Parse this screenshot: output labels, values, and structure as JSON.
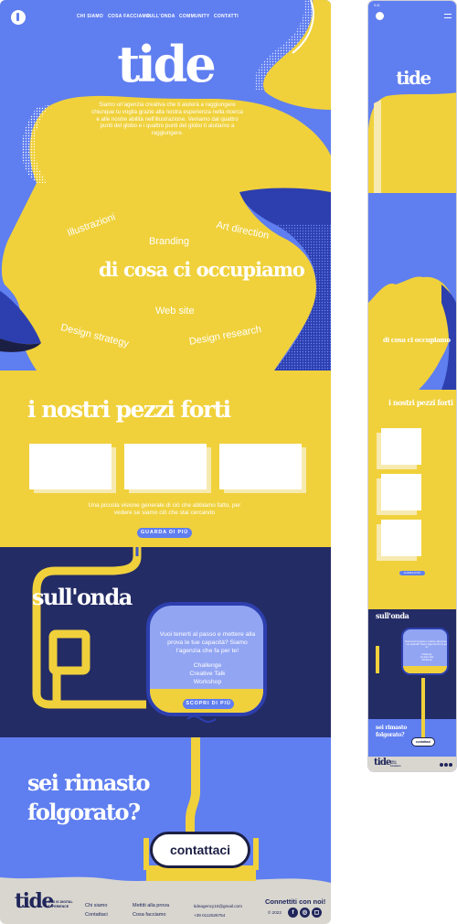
{
  "colors": {
    "blue": "#5f7ef0",
    "yellow": "#f0d13c",
    "navy": "#242c66",
    "ink": "#20265a",
    "beige": "#d8d6cf"
  },
  "nav": {
    "logo_icon": "tide-drop-icon",
    "links": [
      "CHI SIAMO",
      "COSA FACCIAMO",
      "SULL'ONDA",
      "COMMUNITY",
      "CONTATTI"
    ]
  },
  "hero": {
    "brand": "tide",
    "text": "Siamo un'agenzia creativa che ti aiuterà a raggiungere chiunque tu voglia grazie alla nostra esperienza nella ricerca e alle nostre abilità nell'illustrazione. Veniamo dal quattro punti del globo e i quattro punti del globo ti aiutiamo a raggiungere."
  },
  "services": {
    "title": "di cosa ci occupiamo",
    "items": [
      "Illustrazioni",
      "Branding",
      "Art direction",
      "Web site",
      "Design strategy",
      "Design research"
    ]
  },
  "strengths": {
    "title": "i nostri pezzi forti",
    "cards": [
      "",
      "",
      ""
    ],
    "text": "Una piccola visione generale di ciò che abbiamo fatto, per vedere se siamo ciò che stai cercando",
    "button": "GUARDA DI PIÙ"
  },
  "wave": {
    "title": "sull'onda",
    "text": "Vuoi tenerti al passo e mettere alla prova le tue capacità? Siamo l'agenzia che fa per te!",
    "items": [
      "Challenge",
      "Creative Talk",
      "Workshop"
    ],
    "button": "SCOPRI DI PIÙ"
  },
  "contact": {
    "title_line1": "sei rimasto",
    "title_line2": "folgorato?",
    "button": "contattaci"
  },
  "footer": {
    "logo": "tide",
    "tagline": "THIS IS DIGITAL EXPERIENCE",
    "col1": [
      "Chi siamo",
      "Contattaci"
    ],
    "col2": [
      "Mettiti alla prova",
      "Cosa facciamo"
    ],
    "email": "tideagency10@gmail.com",
    "phone": "+39 0112526754",
    "connect": "Connettiti con noi!",
    "copyright": "© 2022",
    "social_icons": [
      "facebook-icon",
      "instagram-icon"
    ]
  },
  "mobile": {
    "status_time": "9:41",
    "brand": "tide",
    "services_title": "di cosa ci occupiamo",
    "strengths_title": "i nostri pezzi forti",
    "strengths_button": "GUARDA DI PIÙ",
    "wave_title": "sull'onda",
    "wave_text": "Vuoi tenerti al passo e mettere alla prova le tue capacità? Siamo l'agenzia che fa per te!",
    "wave_items": [
      "Challenge",
      "Creative Talk",
      "Workshop"
    ],
    "contact_title_line1": "sei rimasto",
    "contact_title_line2": "folgorato?",
    "contact_button": "contattaci",
    "footer_logo": "tide",
    "footer_tagline": "THIS IS DIGITAL EXPERIENCE"
  }
}
